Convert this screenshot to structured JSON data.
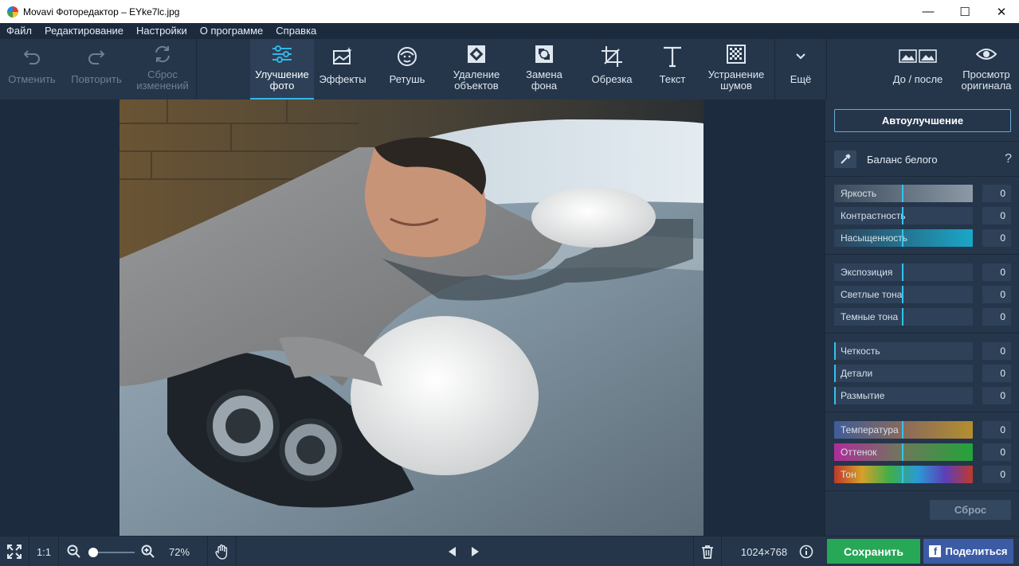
{
  "window": {
    "title": "Movavi Фоторедактор – EYke7lc.jpg",
    "minimize": "—",
    "maximize": "☐",
    "close": "✕"
  },
  "menu": [
    "Файл",
    "Редактирование",
    "Настройки",
    "О программе",
    "Справка"
  ],
  "toolbar": {
    "undo": "Отменить",
    "redo": "Повторить",
    "reset_changes": "Сброс\nизменений",
    "enhance": "Улучшение\nфото",
    "effects": "Эффекты",
    "retouch": "Ретушь",
    "remove_objects": "Удаление\nобъектов",
    "replace_bg": "Замена\nфона",
    "crop": "Обрезка",
    "text": "Текст",
    "denoise": "Устранение\nшумов",
    "more": "Ещё",
    "before_after": "До / после",
    "view_original": "Просмотр\nоригинала"
  },
  "panel": {
    "auto_enhance": "Автоулучшение",
    "white_balance": "Баланс белого",
    "help": "?",
    "groups": [
      [
        {
          "label": "Яркость",
          "value": "0"
        },
        {
          "label": "Контрастность",
          "value": "0"
        },
        {
          "label": "Насыщенность",
          "value": "0"
        }
      ],
      [
        {
          "label": "Экспозиция",
          "value": "0"
        },
        {
          "label": "Светлые тона",
          "value": "0"
        },
        {
          "label": "Темные тона",
          "value": "0"
        }
      ],
      [
        {
          "label": "Четкость",
          "value": "0"
        },
        {
          "label": "Детали",
          "value": "0"
        },
        {
          "label": "Размытие",
          "value": "0"
        }
      ],
      [
        {
          "label": "Температура",
          "value": "0"
        },
        {
          "label": "Оттенок",
          "value": "0"
        },
        {
          "label": "Тон",
          "value": "0"
        }
      ]
    ],
    "reset": "Сброс"
  },
  "status": {
    "ratio": "1:1",
    "zoom": "72%",
    "dimensions": "1024×768",
    "save": "Сохранить",
    "share": "Поделиться",
    "share_badge": "f"
  },
  "colors": {
    "accent": "#33b6e8",
    "save": "#27a857",
    "share": "#3b5ca5"
  },
  "icons": [
    "undo-icon",
    "redo-icon",
    "reset-icon",
    "sliders-icon",
    "effects-icon",
    "retouch-face-icon",
    "remove-objects-icon",
    "replace-bg-icon",
    "crop-icon",
    "text-icon",
    "denoise-icon",
    "chevron-down-icon",
    "before-after-icon",
    "eye-icon",
    "eyedropper-icon",
    "fullscreen-icon",
    "zoom-out-icon",
    "zoom-in-icon",
    "hand-icon",
    "prev-arrow-icon",
    "next-arrow-icon",
    "trash-icon",
    "info-icon"
  ]
}
